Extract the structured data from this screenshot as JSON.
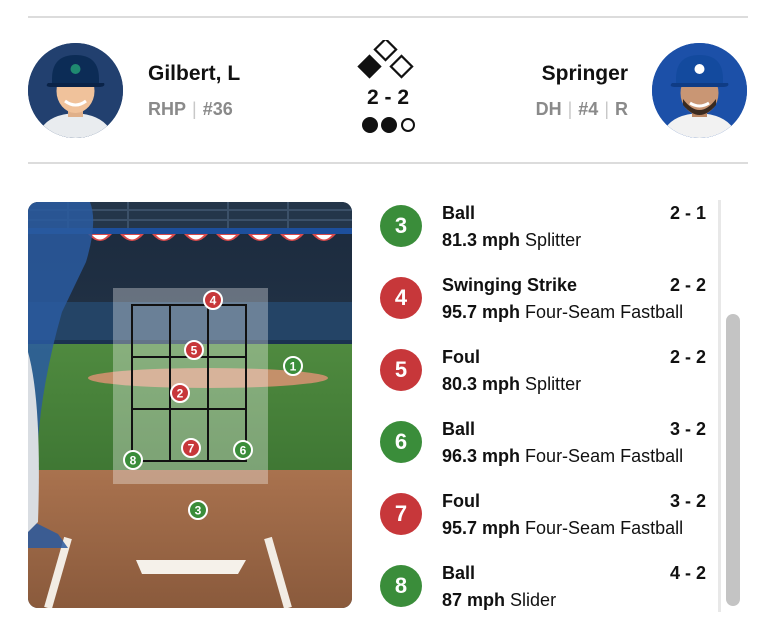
{
  "pitcher": {
    "name": "Gilbert, L",
    "hand": "RHP",
    "number": "#36",
    "photo_icon": "pitcher-headshot",
    "team_color": "#22406f"
  },
  "batter": {
    "name": "Springer",
    "position": "DH",
    "number": "#4",
    "bats": "R",
    "photo_icon": "batter-headshot",
    "team_color": "#1c50a8"
  },
  "situation": {
    "count": "2 - 2",
    "bases": {
      "first": false,
      "second": false,
      "third": true
    },
    "outs": 2,
    "max_outs": 3
  },
  "strike_zone": {
    "pitches": [
      {
        "number": "1",
        "type": "ball"
      },
      {
        "number": "2",
        "type": "strike"
      },
      {
        "number": "3",
        "type": "ball"
      },
      {
        "number": "4",
        "type": "strike"
      },
      {
        "number": "5",
        "type": "strike"
      },
      {
        "number": "6",
        "type": "ball"
      },
      {
        "number": "7",
        "type": "strike"
      },
      {
        "number": "8",
        "type": "ball"
      }
    ]
  },
  "pitch_log": [
    {
      "number": "3",
      "result": "Ball",
      "count": "2 - 1",
      "speed": "81.3 mph",
      "pitch_type": "Splitter",
      "kind": "ball"
    },
    {
      "number": "4",
      "result": "Swinging Strike",
      "count": "2 - 2",
      "speed": "95.7 mph",
      "pitch_type": "Four-Seam Fastball",
      "kind": "strike"
    },
    {
      "number": "5",
      "result": "Foul",
      "count": "2 - 2",
      "speed": "80.3 mph",
      "pitch_type": "Splitter",
      "kind": "strike"
    },
    {
      "number": "6",
      "result": "Ball",
      "count": "3 - 2",
      "speed": "96.3 mph",
      "pitch_type": "Four-Seam Fastball",
      "kind": "ball"
    },
    {
      "number": "7",
      "result": "Foul",
      "count": "3 - 2",
      "speed": "95.7 mph",
      "pitch_type": "Four-Seam Fastball",
      "kind": "strike"
    },
    {
      "number": "8",
      "result": "Ball",
      "count": "4 - 2",
      "speed": "87 mph",
      "pitch_type": "Slider",
      "kind": "ball"
    }
  ],
  "colors": {
    "ball": "#3a8d3a",
    "strike": "#c7373a",
    "divider": "#dcdcdc",
    "muted_text": "#8a8a8a"
  }
}
